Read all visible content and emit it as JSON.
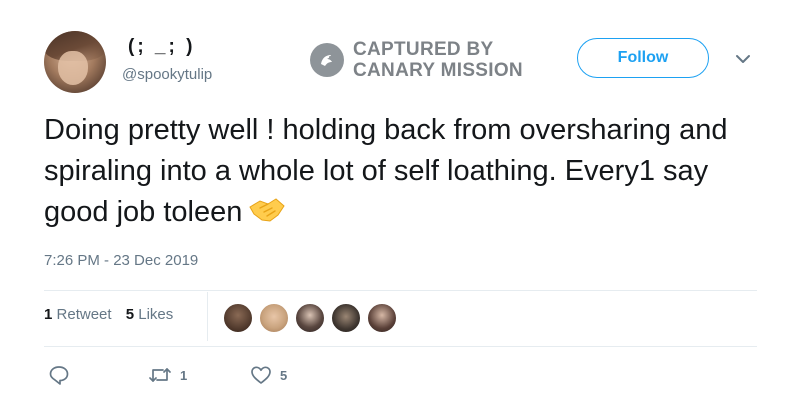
{
  "user": {
    "display_name": "(; _; )",
    "handle": "@spookytulip",
    "avatar_icon": "avatar"
  },
  "watermark": {
    "line1": "CAPTURED BY",
    "line2": "CANARY MISSION",
    "icon": "bird-icon"
  },
  "header": {
    "follow_label": "Follow",
    "menu_icon": "chevron-down-icon"
  },
  "tweet": {
    "text": "Doing pretty well ! holding back from oversharing and spiraling into a whole lot of self loathing. Every1 say good job toleen",
    "emoji": "handshake-icon",
    "timestamp": "7:26 PM - 23 Dec 2019"
  },
  "stats": {
    "retweet_count": "1",
    "retweet_label": "Retweet",
    "like_count": "5",
    "like_label": "Likes",
    "likers": [
      "liker-1",
      "liker-2",
      "liker-3",
      "liker-4",
      "liker-5"
    ]
  },
  "actions": {
    "reply_icon": "reply-icon",
    "retweet_icon": "retweet-icon",
    "retweet_count": "1",
    "like_icon": "heart-icon",
    "like_count": "5"
  },
  "colors": {
    "accent": "#1da1f2",
    "text": "#14171a",
    "secondary": "#657786",
    "divider": "#e6ecf0",
    "watermark": "#7d8287",
    "emoji": "#ffcc4d"
  }
}
